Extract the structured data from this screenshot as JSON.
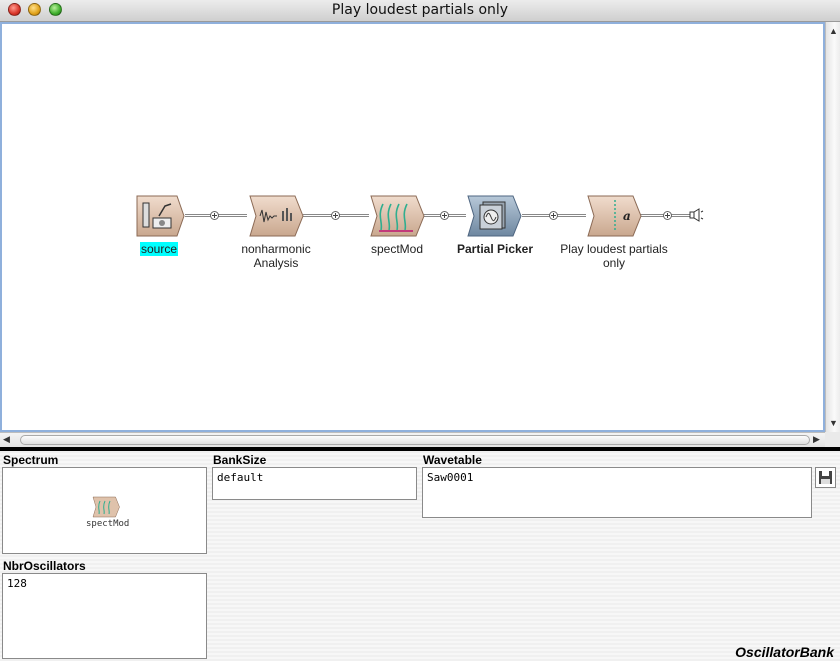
{
  "window": {
    "title": "Play loudest partials only"
  },
  "nodes": [
    {
      "label": "source",
      "icon": "sound-source-icon",
      "selected": true
    },
    {
      "label": "nonharmonic\nAnalysis",
      "icon": "waveform-analysis-icon"
    },
    {
      "label": "spectMod",
      "icon": "spectrum-modifier-icon"
    },
    {
      "label": "Partial Picker",
      "icon": "partial-picker-icon",
      "bold": true
    },
    {
      "label": "Play loudest partials\nonly",
      "icon": "oscillator-bank-icon"
    }
  ],
  "panel": {
    "spectrum": {
      "label": "Spectrum",
      "thumbnail_label": "spectMod"
    },
    "banksize": {
      "label": "BankSize",
      "value": "default"
    },
    "wavetable": {
      "label": "Wavetable",
      "value": "Saw0001"
    },
    "nbr_oscillators": {
      "label": "NbrOscillators",
      "value": "128"
    },
    "class_name": "OscillatorBank"
  },
  "colors": {
    "selection": "#00ffff",
    "canvas_border": "#8fb0dc",
    "node_fill": "#e0c0a8"
  }
}
